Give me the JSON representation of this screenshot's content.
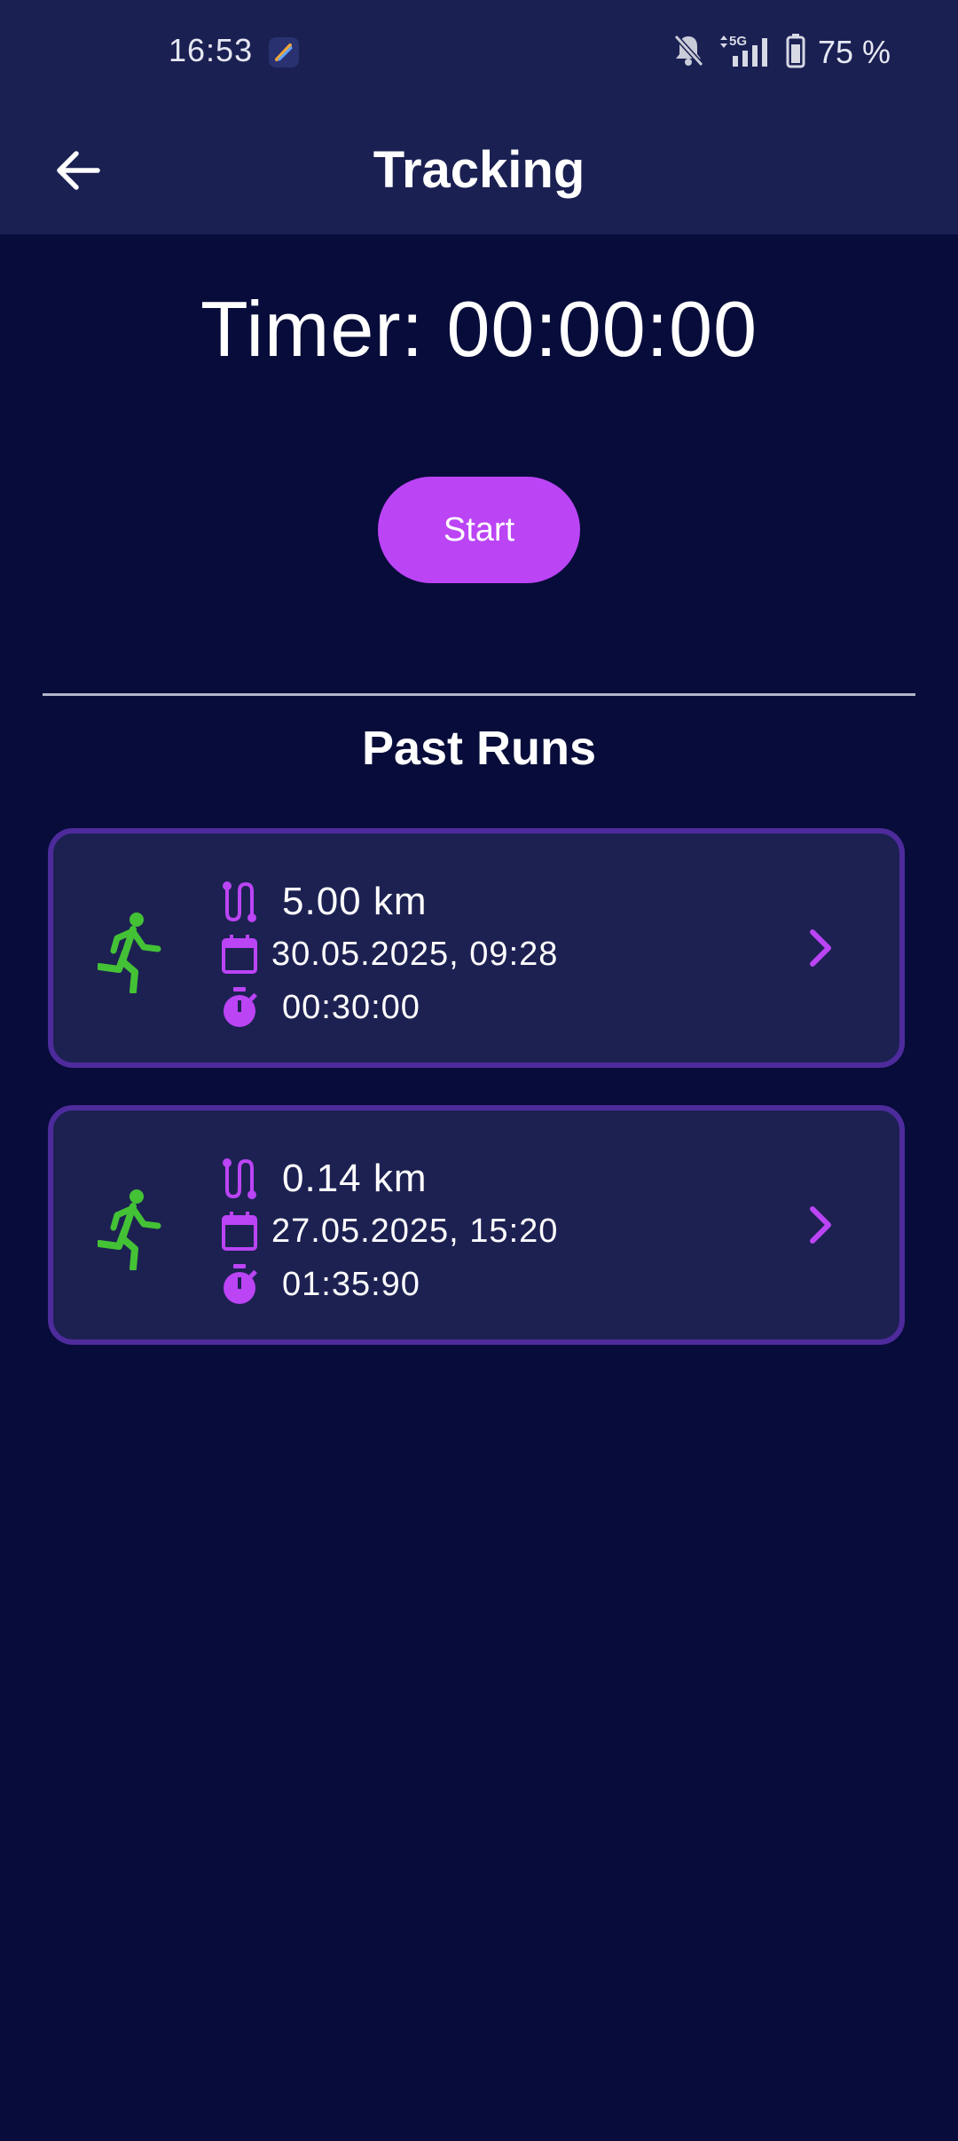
{
  "status_bar": {
    "time": "16:53",
    "network": "5G",
    "battery": "75 %"
  },
  "app_bar": {
    "title": "Tracking"
  },
  "timer": {
    "text": "Timer: 00:00:00"
  },
  "controls": {
    "start_label": "Start"
  },
  "past_runs": {
    "title": "Past Runs",
    "runs": [
      {
        "distance": "5.00 km",
        "date": "30.05.2025, 09:28",
        "duration": "00:30:00"
      },
      {
        "distance": "0.14 km",
        "date": "27.05.2025, 15:20",
        "duration": "01:35:90"
      }
    ]
  },
  "colors": {
    "background": "#070c3a",
    "bar": "#1b2053",
    "accent": "#bb44f5",
    "run_icon": "#44c236",
    "card_border": "#4e2b9c"
  },
  "icons": [
    "back-arrow-icon",
    "route-icon",
    "calendar-icon",
    "stopwatch-icon",
    "running-icon",
    "chevron-right-icon",
    "notifications-off-icon",
    "signal-icon",
    "battery-icon"
  ]
}
